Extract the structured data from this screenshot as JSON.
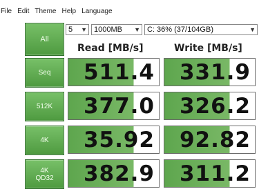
{
  "menu": [
    "File",
    "Edit",
    "Theme",
    "Help",
    "Language"
  ],
  "controls": {
    "all_label": "All",
    "count_value": "5",
    "size_value": "1000MB",
    "drive_value": "C: 36% (37/104GB)"
  },
  "headers": {
    "read": "Read [MB/s]",
    "write": "Write [MB/s]"
  },
  "rows": [
    {
      "label": "Seq",
      "label2": "",
      "read": "511.4",
      "write": "331.9"
    },
    {
      "label": "512K",
      "label2": "",
      "read": "377.0",
      "write": "326.2"
    },
    {
      "label": "4K",
      "label2": "",
      "read": "35.92",
      "write": "92.82"
    },
    {
      "label": "4K",
      "label2": "QD32",
      "read": "382.9",
      "write": "311.2"
    }
  ],
  "colors": {
    "button_green": "#5ea64e",
    "bar_green": "#79b866",
    "cell_border": "#6c6c6c"
  }
}
